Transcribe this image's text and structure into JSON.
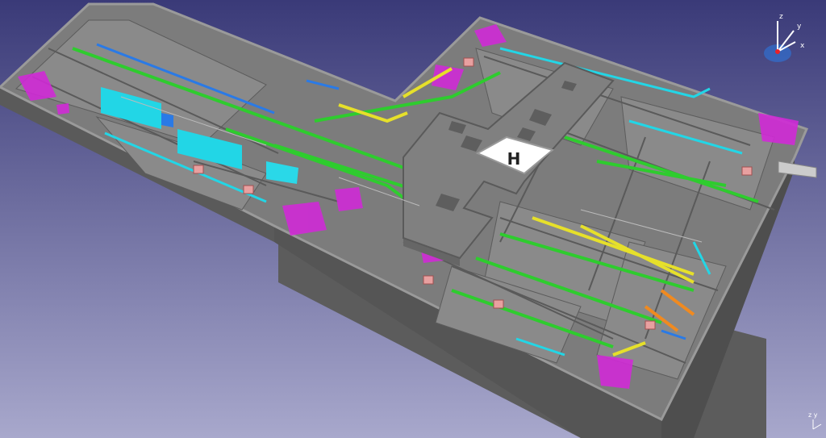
{
  "viewport": {
    "background_top": "#3a3a78",
    "background_bottom": "#a8a8cc"
  },
  "model": {
    "slab_top": "#7c7c7c",
    "slab_side": "#5a5a5a",
    "wall": "#6e6e6e",
    "room_floor": "#8c8c8c",
    "upper_block": "#808080",
    "helipad_label": "H",
    "colors": {
      "green": "#2ecc2e",
      "cyan": "#22d6e6",
      "yellow": "#e6e02a",
      "magenta": "#d02ad6",
      "orange": "#f08a20",
      "blue": "#2a7ae6",
      "pink": "#e8a0a0",
      "white": "#eeeeee"
    }
  },
  "compass": {
    "x_label": "x",
    "y_label": "y",
    "z_label": "z"
  },
  "mini_axis": {
    "label": "z y"
  }
}
